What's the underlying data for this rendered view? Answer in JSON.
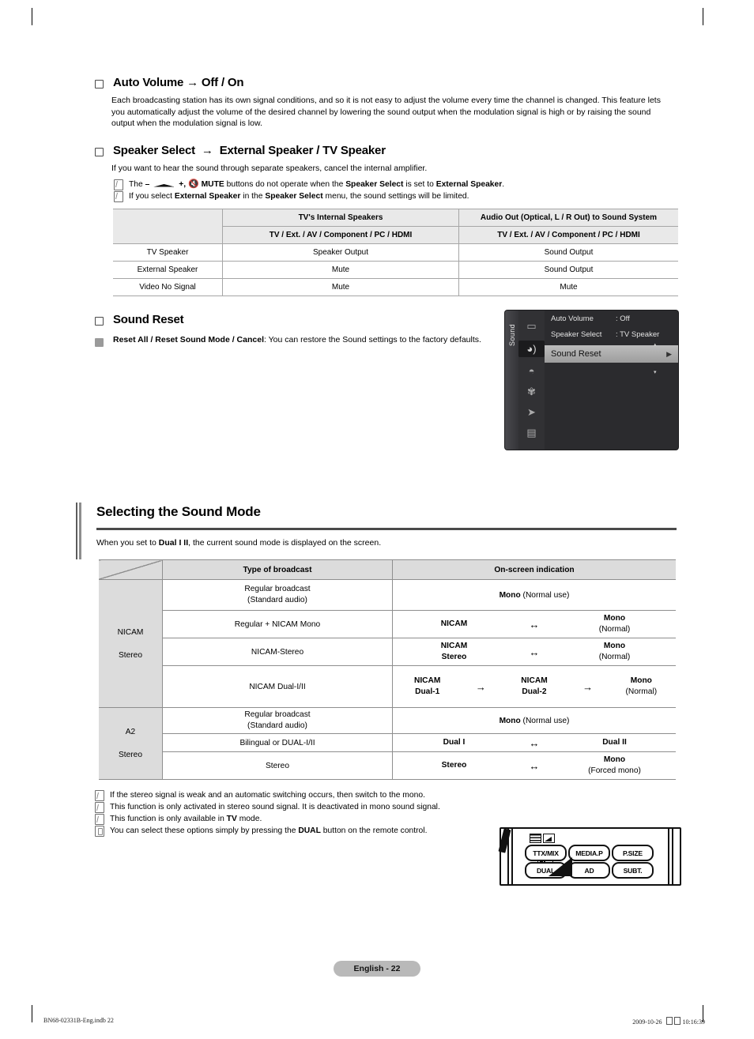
{
  "doc": {
    "page_label": "English - 22",
    "footer_left": "BN68-02331B-Eng.indb   22",
    "footer_right_date": "2009-10-26",
    "footer_right_time": "10:16:39"
  },
  "sections": {
    "auto_volume": {
      "heading": "Auto Volume → Off / On",
      "body": "Each broadcasting station has its own signal conditions, and so it is not easy to adjust the volume every time the channel is changed. This feature lets you automatically adjust the volume of the desired channel by lowering the sound output when the modulation signal is high or by raising the sound output when the modulation signal is low."
    },
    "speaker_select": {
      "heading_part1": "Speaker Select",
      "heading_arrow": "→",
      "heading_part2": "External Speaker / TV Speaker",
      "body": "If you want to hear the sound through separate speakers, cancel the internal amplifier.",
      "note1_a": "The",
      "note1_b": "–",
      "note1_c": "+,",
      "note1_d": "MUTE",
      "note1_e": "buttons do not operate when the",
      "note1_f": "Speaker Select",
      "note1_g": "is set to",
      "note1_h": "External Speaker",
      "note1_i": ".",
      "note2_a": "If you select",
      "note2_b": "External Speaker",
      "note2_c": "in the",
      "note2_d": "Speaker Select",
      "note2_e": "menu, the sound settings will be limited."
    },
    "sound_reset": {
      "heading": "Sound Reset",
      "body_bold": "Reset All / Reset Sound Mode / Cancel",
      "body_rest": ": You can restore the Sound settings to the factory defaults."
    }
  },
  "speaker_table": {
    "header_top": [
      "",
      "TV's Internal Speakers",
      "Audio Out (Optical, L / R Out) to Sound System"
    ],
    "header_sub": [
      "",
      "TV / Ext. / AV / Component / PC / HDMI",
      "TV / Ext. / AV / Component / PC / HDMI"
    ],
    "rows": [
      [
        "TV Speaker",
        "Speaker Output",
        "Sound Output"
      ],
      [
        "External Speaker",
        "Mute",
        "Sound Output"
      ],
      [
        "Video No Signal",
        "Mute",
        "Mute"
      ]
    ]
  },
  "osd": {
    "rail_label": "Sound",
    "items": [
      {
        "label": "Auto Volume",
        "value": ": Off"
      },
      {
        "label": "Speaker Select",
        "value": ": TV Speaker"
      }
    ],
    "highlighted": {
      "label": "Sound Reset",
      "caret": "▶"
    },
    "icons": [
      "picture-icon",
      "sound-icon",
      "channel-icon",
      "setup-icon",
      "input-icon",
      "application-icon",
      "support-icon"
    ],
    "scroll_up": "▴",
    "scroll_down": "▾"
  },
  "sound_mode": {
    "title": "Selecting the Sound Mode",
    "intro_a": "When you set to",
    "intro_b": "Dual I II",
    "intro_c": ", the current sound mode is displayed on the screen.",
    "headers": [
      "",
      "Type of broadcast",
      "On-screen indication"
    ],
    "groups": [
      {
        "name_line1": "NICAM",
        "name_line2": "Stereo",
        "rows": [
          {
            "type_line1": "Regular broadcast",
            "type_line2": "(Standard audio)",
            "indication_single_bold": "Mono",
            "indication_single_rest": " (Normal use)"
          },
          {
            "type_line1": "Regular + NICAM Mono",
            "type_line2": "",
            "cells": [
              {
                "bold": "NICAM",
                "sub": ""
              },
              {
                "bold": "Mono",
                "sub": "(Normal)"
              }
            ],
            "arrows": [
              "↔"
            ]
          },
          {
            "type_line1": "NICAM-Stereo",
            "type_line2": "",
            "cells": [
              {
                "bold": "NICAM",
                "bold2": "Stereo",
                "sub": ""
              },
              {
                "bold": "Mono",
                "sub": "(Normal)"
              }
            ],
            "arrows": [
              "↔"
            ]
          },
          {
            "type_line1": "NICAM Dual-I/II",
            "type_line2": "",
            "cells": [
              {
                "bold": "NICAM",
                "bold2": "Dual-1",
                "sub": ""
              },
              {
                "bold": "NICAM",
                "bold2": "Dual-2",
                "sub": ""
              },
              {
                "bold": "Mono",
                "sub": "(Normal)"
              }
            ],
            "arrows": [
              "→",
              "→"
            ]
          }
        ]
      },
      {
        "name_line1": "A2",
        "name_line2": "Stereo",
        "rows": [
          {
            "type_line1": "Regular broadcast",
            "type_line2": "(Standard audio)",
            "indication_single_bold": "Mono",
            "indication_single_rest": " (Normal use)"
          },
          {
            "type_line1": "Bilingual or DUAL-I/II",
            "type_line2": "",
            "cells": [
              {
                "bold": "Dual I",
                "sub": ""
              },
              {
                "bold": "Dual II",
                "sub": ""
              }
            ],
            "arrows": [
              "↔"
            ]
          },
          {
            "type_line1": "Stereo",
            "type_line2": "",
            "cells": [
              {
                "bold": "Stereo",
                "sub": ""
              },
              {
                "bold": "Mono",
                "sub": "(Forced mono)"
              }
            ],
            "arrows": [
              "↔"
            ]
          }
        ]
      }
    ],
    "notes": [
      {
        "icon": "note-icon",
        "text": "If the stereo signal is weak and an automatic switching occurs, then switch to the mono."
      },
      {
        "icon": "note-icon",
        "text": "This function is only activated in stereo sound signal. It is deactivated in mono sound signal."
      },
      {
        "icon": "note-icon",
        "text_a": "This function is only available in ",
        "bold": "TV",
        "text_b": " mode."
      },
      {
        "icon": "hand-icon",
        "text_a": "You can select these options simply by pressing the ",
        "bold": "DUAL",
        "text_b": " button on the remote control."
      }
    ]
  },
  "remote": {
    "buttons": [
      "TTX/MIX",
      "MEDIA.P",
      "P.SIZE",
      "DUAL",
      "AD",
      "SUBT."
    ]
  }
}
